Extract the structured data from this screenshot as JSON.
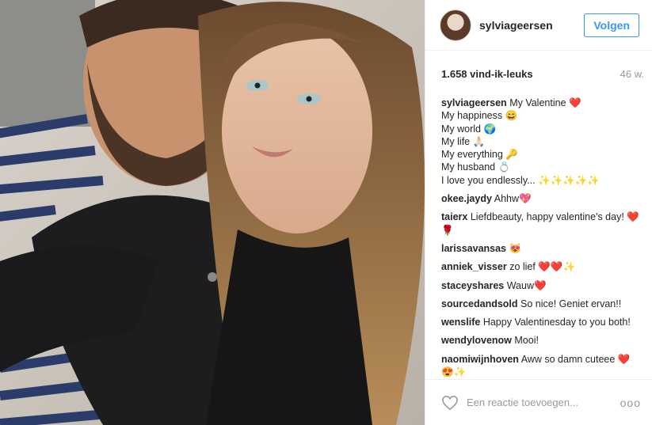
{
  "post": {
    "username": "sylviageersen",
    "follow_label": "Volgen",
    "likes": "1.658 vind-ik-leuks",
    "time": "46 w.",
    "caption": [
      "My Valentine ❤️",
      "My happiness 😄",
      "My world 🌍",
      "My life 🙏🏻",
      "My everything 🔑",
      "My husband 💍",
      "I love you endlessly... ✨✨✨✨✨"
    ],
    "comments": [
      {
        "user": "okee.jaydy",
        "text": "Ahhw💖"
      },
      {
        "user": "taierx",
        "text": "Liefdbeauty, happy valentine's day! ❤️🌹"
      },
      {
        "user": "larissavansas",
        "text": "😻"
      },
      {
        "user": "anniek_visser",
        "text": "zo lief ❤️❤️✨"
      },
      {
        "user": "staceyshares",
        "text": "Wauw❤️"
      },
      {
        "user": "sourcedandsold",
        "text": "So nice! Geniet ervan!!"
      },
      {
        "user": "wenslife",
        "text": "Happy Valentinesday to you both!"
      },
      {
        "user": "wendylovenow",
        "text": "Mooi!"
      },
      {
        "user": "naomiwijnhoven",
        "text": "Aww so damn cuteee ❤️😍✨"
      }
    ],
    "add_comment_placeholder": "Een reactie toevoegen...",
    "more_label": "ooo"
  }
}
